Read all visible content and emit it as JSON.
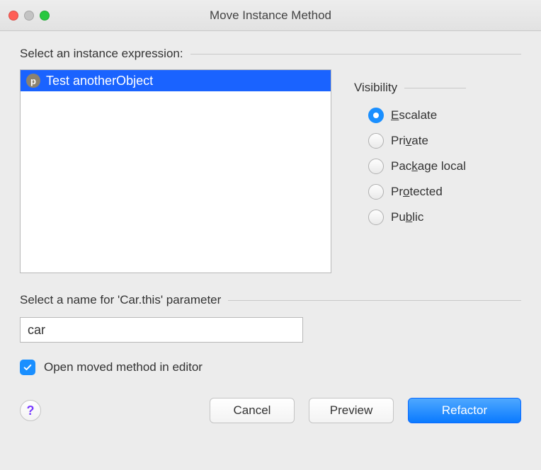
{
  "window": {
    "title": "Move Instance Method"
  },
  "instanceSection": {
    "label": "Select an instance expression:",
    "items": [
      {
        "badge": "p",
        "label": "Test anotherObject",
        "selected": true
      }
    ]
  },
  "visibility": {
    "header": "Visibility",
    "options": [
      {
        "pre": "",
        "mn": "E",
        "post": "scalate",
        "checked": true
      },
      {
        "pre": "Pri",
        "mn": "v",
        "post": "ate",
        "checked": false
      },
      {
        "pre": "Pac",
        "mn": "k",
        "post": "age local",
        "checked": false
      },
      {
        "pre": "Pr",
        "mn": "o",
        "post": "tected",
        "checked": false
      },
      {
        "pre": "Pu",
        "mn": "b",
        "post": "lic",
        "checked": false
      }
    ]
  },
  "nameSection": {
    "label": "Select a name for 'Car.this' parameter",
    "value": "car"
  },
  "openCheckbox": {
    "label": "Open moved method in editor",
    "checked": true
  },
  "buttons": {
    "help": "?",
    "cancel": "Cancel",
    "preview": "Preview",
    "refactor": "Refactor"
  }
}
